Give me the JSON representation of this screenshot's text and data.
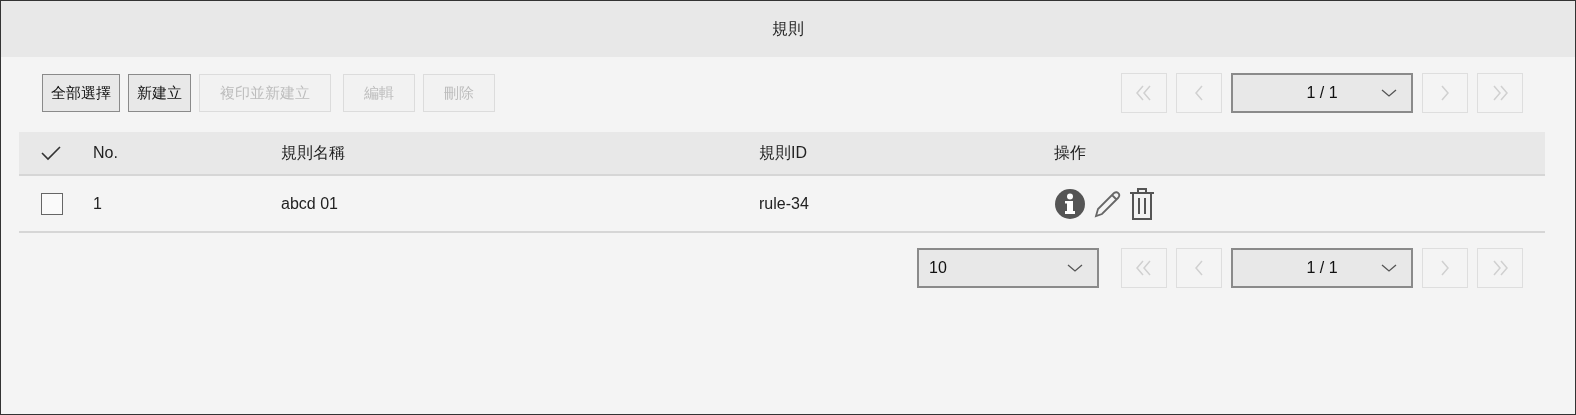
{
  "window": {
    "title": "規則"
  },
  "toolbar": {
    "buttons": [
      {
        "label": "全部選擇",
        "disabled": false
      },
      {
        "label": "新建立",
        "disabled": false
      },
      {
        "label": "複印並新建立",
        "disabled": true
      },
      {
        "label": "編輯",
        "disabled": true
      },
      {
        "label": "刪除",
        "disabled": true
      }
    ]
  },
  "pager_top": {
    "page": "1 / 1",
    "nav": [
      {
        "kind": "first",
        "disabled": true
      },
      {
        "kind": "prev",
        "disabled": true
      },
      {
        "kind": "next",
        "disabled": true
      },
      {
        "kind": "last",
        "disabled": true
      }
    ]
  },
  "table": {
    "columns": [
      "No.",
      "規則名稱",
      "規則ID",
      "操作"
    ],
    "rows": [
      {
        "checked": false,
        "cells": [
          "1",
          "abcd 01",
          "rule-34"
        ],
        "actions": [
          {
            "kind": "info"
          },
          {
            "kind": "edit"
          },
          {
            "kind": "delete"
          }
        ]
      }
    ]
  },
  "pager_bottom": {
    "page_size": "10",
    "page": "1 / 1",
    "nav": [
      {
        "kind": "first",
        "disabled": true
      },
      {
        "kind": "prev",
        "disabled": true
      },
      {
        "kind": "next",
        "disabled": true
      },
      {
        "kind": "last",
        "disabled": true
      }
    ]
  }
}
